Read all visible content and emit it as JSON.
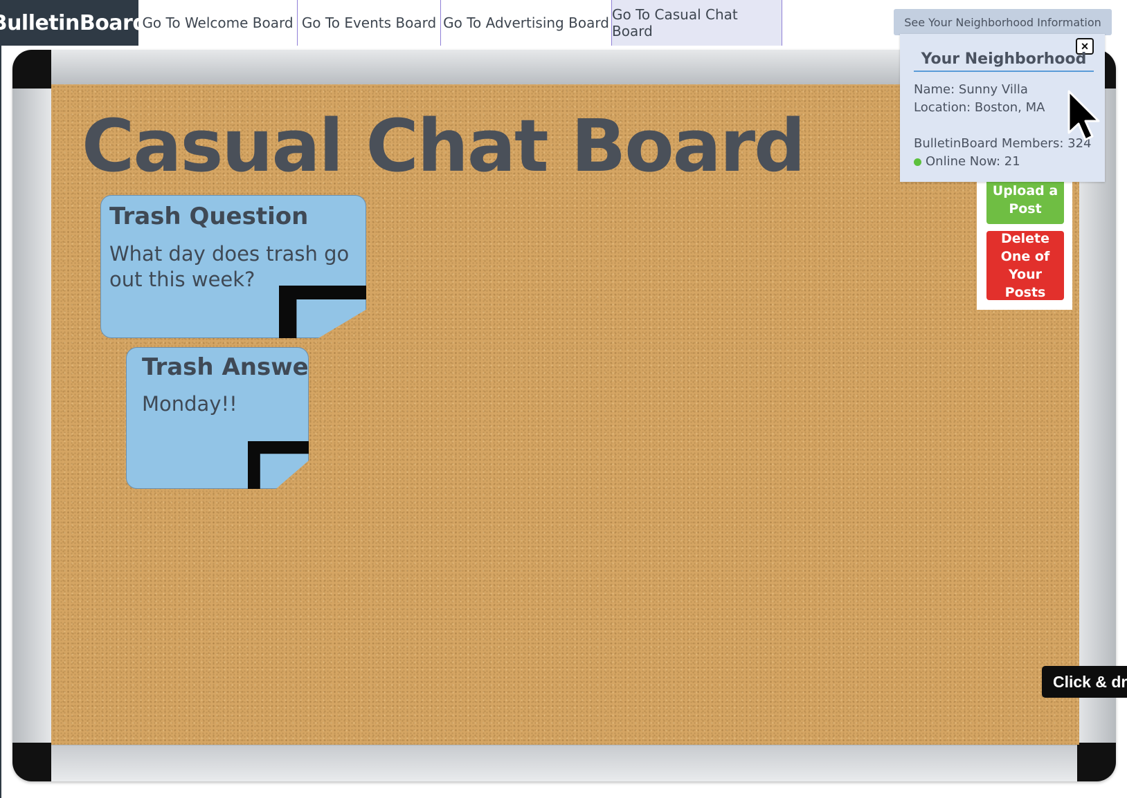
{
  "nav": {
    "brand": "BulletinBoard",
    "tabs": [
      {
        "label": "Go To Welcome Board"
      },
      {
        "label": "Go To Events Board"
      },
      {
        "label": "Go To Advertising Board"
      },
      {
        "label": "Go To Casual Chat Board",
        "active": true
      }
    ],
    "neighborhood_button": "See Your Neighborhood Information"
  },
  "board": {
    "title": "Casual Chat Board",
    "posts": [
      {
        "title": "Trash Question",
        "body": "What day does trash go out this week?"
      },
      {
        "title": "Trash Answer",
        "body": "Monday!!"
      }
    ]
  },
  "actions": {
    "upload": "Upload a Post",
    "delete": "Delete One of Your Posts"
  },
  "popup": {
    "close_icon": "×",
    "title": "Your Neighborhood",
    "name_line": "Name:  Sunny Villa",
    "location_line": "Location: Boston, MA",
    "members_line": "BulletinBoard Members: 324",
    "online_line": "Online Now: 21"
  },
  "tooltip": "Click & drag",
  "colors": {
    "brand_bg": "#2f3a45",
    "post": "#92c4e6",
    "upload": "#6fbe43",
    "delete": "#e2302c",
    "cork": "#d5a563",
    "online": "#5cc13d"
  }
}
